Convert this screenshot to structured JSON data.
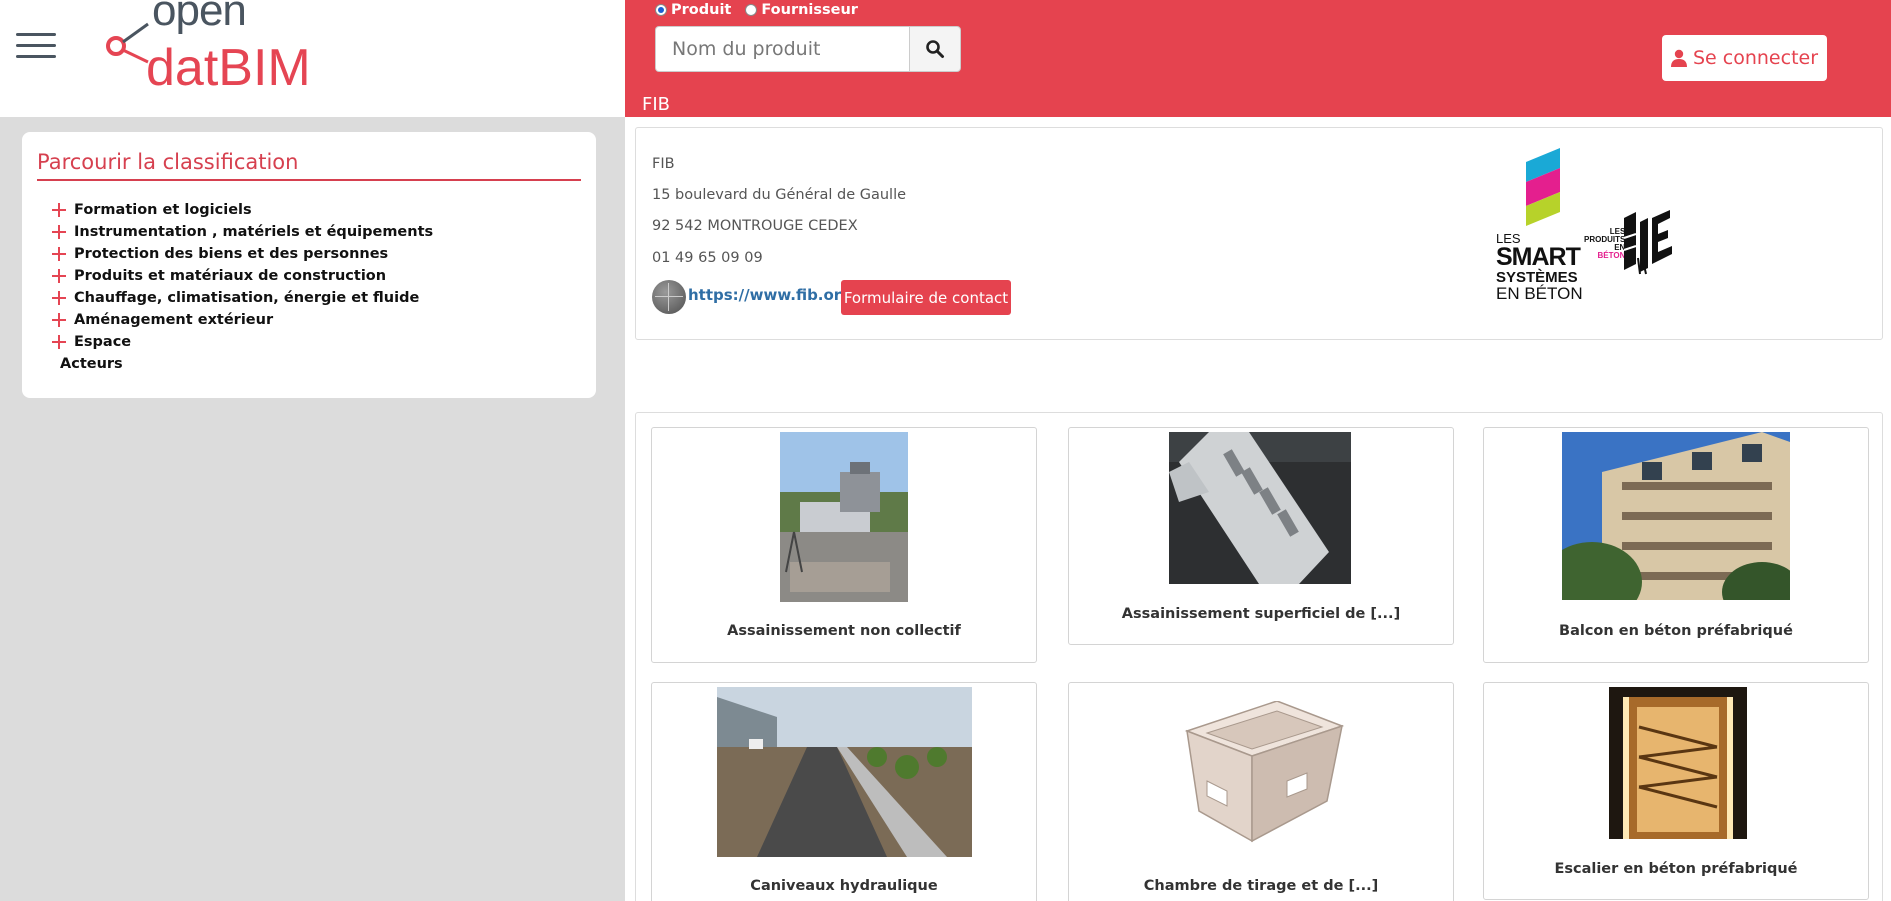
{
  "header": {
    "logo_top": "open",
    "logo_bottom": "datBIM",
    "menu_icon": "hamburger-icon"
  },
  "sidebar": {
    "title": "Parcourir la classification",
    "items": [
      {
        "label": "Formation et logiciels",
        "expandable": true
      },
      {
        "label": "Instrumentation , matériels et équipements",
        "expandable": true
      },
      {
        "label": "Protection des biens et des personnes",
        "expandable": true
      },
      {
        "label": "Produits et matériaux de construction",
        "expandable": true
      },
      {
        "label": "Chauffage, climatisation, énergie et fluide",
        "expandable": true
      },
      {
        "label": "Aménagement extérieur",
        "expandable": true
      },
      {
        "label": "Espace",
        "expandable": true
      },
      {
        "label": "Acteurs",
        "expandable": false
      }
    ]
  },
  "search": {
    "radio_product": "Produit",
    "radio_supplier": "Fournisseur",
    "selected": "Produit",
    "placeholder": "Nom du produit",
    "icon": "search-icon"
  },
  "login": {
    "label": "Se connecter",
    "icon": "user-icon"
  },
  "supplier": {
    "bar_label": "FIB",
    "name": "FIB",
    "address": "15 boulevard du Général de Gaulle",
    "city": "92 542 MONTROUGE CEDEX",
    "phone": "01 49 65 09 09",
    "website": "https://www.fib.org",
    "contact_button": "Formulaire de contact",
    "logo_lines": [
      "LES",
      "SMART",
      "SYSTÈMES",
      "EN BÉTON"
    ],
    "logo2_lines": [
      "LES",
      "PRODUITS",
      "EN",
      "BÉTON"
    ]
  },
  "products": [
    {
      "label": "Assainissement non collectif"
    },
    {
      "label": "Assainissement superficiel de [...]"
    },
    {
      "label": "Balcon en béton préfabriqué"
    },
    {
      "label": "Caniveaux hydraulique"
    },
    {
      "label": "Chambre de tirage et de [...]"
    },
    {
      "label": "Escalier en béton préfabriqué"
    }
  ],
  "colors": {
    "brand_red": "#e5434f",
    "link_blue": "#2f6ea5",
    "sidebar_bg": "#dcdcdc"
  }
}
